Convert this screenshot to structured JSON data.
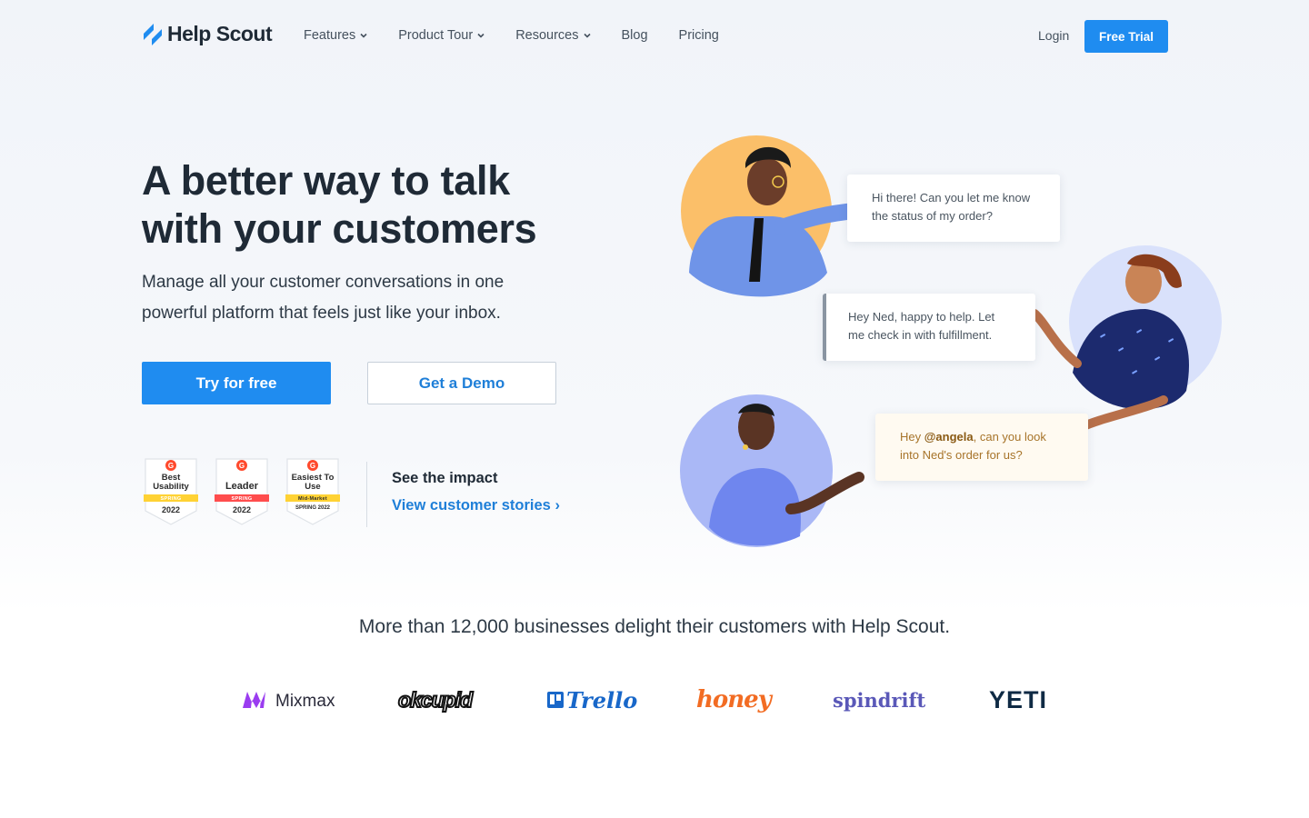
{
  "nav": {
    "brand": "Help Scout",
    "links": [
      {
        "label": "Features",
        "dropdown": true
      },
      {
        "label": "Product Tour",
        "dropdown": true
      },
      {
        "label": "Resources",
        "dropdown": true
      },
      {
        "label": "Blog",
        "dropdown": false
      },
      {
        "label": "Pricing",
        "dropdown": false
      }
    ],
    "login": "Login",
    "cta": "Free Trial"
  },
  "hero": {
    "title_line1": "A better way to talk",
    "title_line2": "with your customers",
    "subtitle_line1": "Manage all your customer conversations in one",
    "subtitle_line2": "powerful platform that feels just like your inbox.",
    "primary_cta": "Try for free",
    "secondary_cta": "Get a Demo"
  },
  "badges": [
    {
      "title": "Best Usability",
      "band": "SPRING",
      "year": "2022",
      "band_color": "#ffd234"
    },
    {
      "title": "Leader",
      "band": "SPRING",
      "year": "2022",
      "band_color": "#ff4d4d"
    },
    {
      "title": "Easiest To Use",
      "band": "Mid-Market",
      "year": "SPRING 2022",
      "band_color": "#ffd234"
    }
  ],
  "impact": {
    "label": "See the impact",
    "link": "View customer stories ›"
  },
  "chat": {
    "bubble1": "Hi there! Can you let me know the status of my order?",
    "bubble2": "Hey Ned, happy to help. Let me check in with fulfillment.",
    "bubble3_prefix": "Hey ",
    "bubble3_mention": "@angela",
    "bubble3_suffix": ", can you look into Ned's order for us?"
  },
  "social_proof": {
    "tagline": "More than 12,000 businesses delight their customers with Help Scout.",
    "logos": [
      "Mixmax",
      "okcupid",
      "Trello",
      "honey",
      "spindrift",
      "YETI"
    ]
  },
  "colors": {
    "brand_blue": "#1f8cf0",
    "link_blue": "#1f7fd8",
    "text_dark": "#1f2a36"
  }
}
